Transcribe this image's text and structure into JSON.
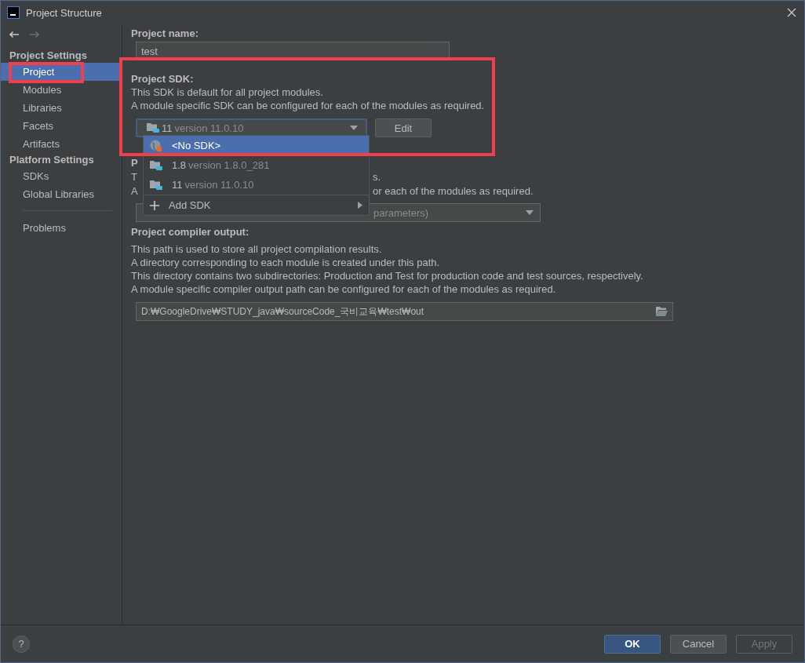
{
  "window": {
    "title": "Project Structure"
  },
  "sidebar": {
    "sections": [
      {
        "heading": "Project Settings",
        "items": [
          {
            "label": "Project",
            "selected": true,
            "highlighted": true
          },
          {
            "label": "Modules",
            "selected": false,
            "highlighted": false
          },
          {
            "label": "Libraries",
            "selected": false,
            "highlighted": false
          },
          {
            "label": "Facets",
            "selected": false,
            "highlighted": false
          },
          {
            "label": "Artifacts",
            "selected": false,
            "highlighted": false
          }
        ]
      },
      {
        "heading": "Platform Settings",
        "items": [
          {
            "label": "SDKs",
            "selected": false,
            "highlighted": false
          },
          {
            "label": "Global Libraries",
            "selected": false,
            "highlighted": false
          }
        ]
      }
    ],
    "extra_items": [
      {
        "label": "Problems",
        "selected": false,
        "highlighted": false
      }
    ]
  },
  "project_name": {
    "label": "Project name:",
    "value": "test"
  },
  "project_sdk": {
    "label": "Project SDK:",
    "highlighted": true,
    "description": [
      "This SDK is default for all project modules.",
      "A module specific SDK can be configured for each of the modules as required."
    ],
    "combo": {
      "name": "11",
      "version": "version 11.0.10"
    },
    "edit_button": "Edit",
    "popup": [
      {
        "kind": "none",
        "name": "<No SDK>",
        "selected": true
      },
      {
        "kind": "jdk",
        "name": "1.8",
        "version": "version 1.8.0_281",
        "selected": false
      },
      {
        "kind": "jdk",
        "name": "11",
        "version": "version 11.0.10",
        "selected": false
      },
      {
        "kind": "add",
        "name": "Add SDK",
        "selected": false
      }
    ]
  },
  "language_level": {
    "heading": "P",
    "lines": [
      {
        "left": "T",
        "right": "s."
      },
      {
        "left": "A",
        "right": "or each of the modules as required."
      }
    ],
    "combo_text": "parameters)"
  },
  "compiler_output": {
    "label": "Project compiler output:",
    "description": [
      "This path is used to store all project compilation results.",
      "A directory corresponding to each module is created under this path.",
      "This directory contains two subdirectories: Production and Test for production code and test sources, respectively.",
      "A module specific compiler output path can be configured for each of the modules as required."
    ],
    "path": "D:₩GoogleDrive₩STUDY_java₩sourceCode_국비교육₩test₩out"
  },
  "help": "?",
  "buttons": [
    {
      "label": "OK",
      "kind": "primary",
      "disabled": false
    },
    {
      "label": "Cancel",
      "kind": "normal",
      "disabled": false
    },
    {
      "label": "Apply",
      "kind": "normal",
      "disabled": true
    }
  ]
}
